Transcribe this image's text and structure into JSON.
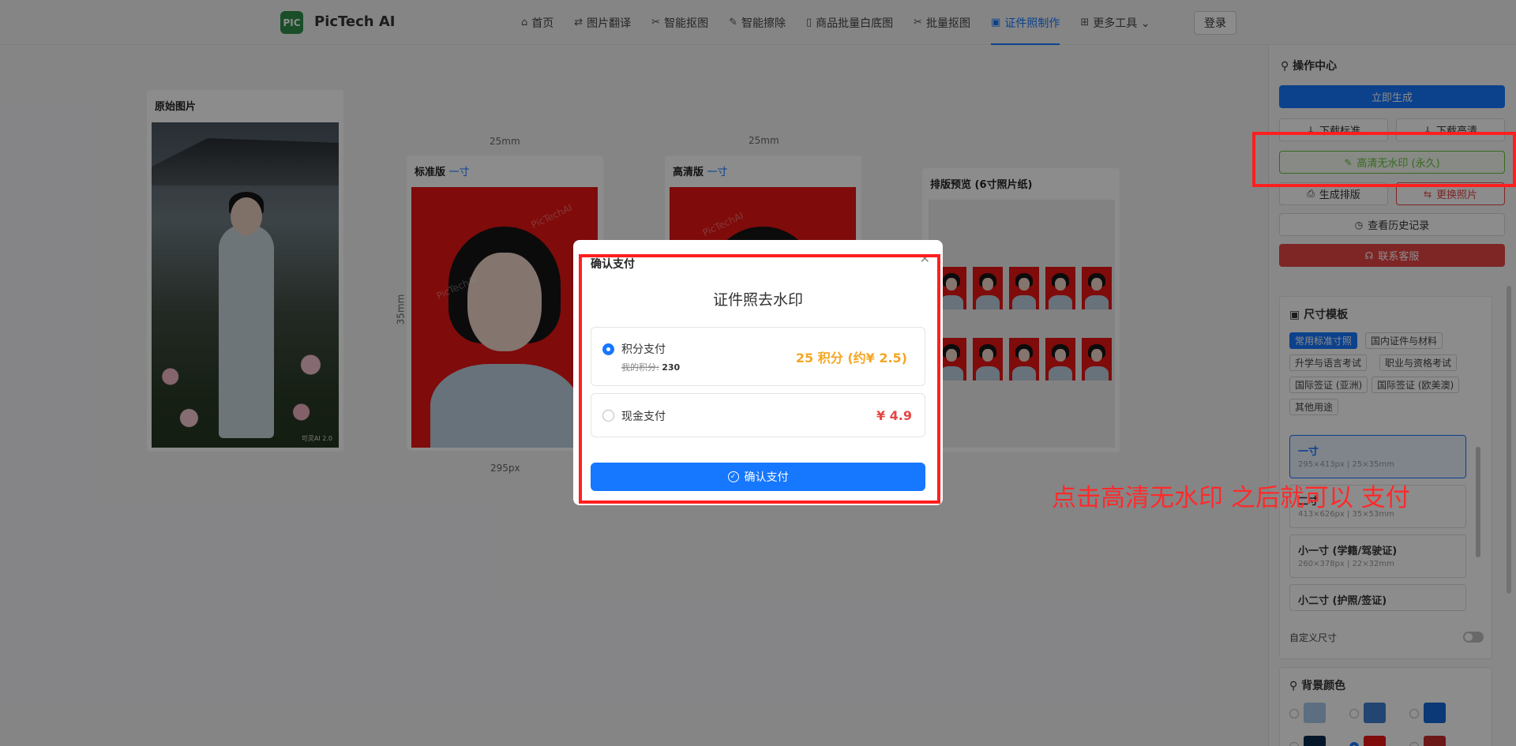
{
  "header": {
    "logo_text": "PIC",
    "brand": "PicTech AI",
    "nav": [
      {
        "icon": "⌂",
        "label": "首页"
      },
      {
        "icon": "⇄",
        "label": "图片翻译"
      },
      {
        "icon": "✂",
        "label": "智能抠图"
      },
      {
        "icon": "✎",
        "label": "智能擦除"
      },
      {
        "icon": "▯",
        "label": "商品批量白底图"
      },
      {
        "icon": "✂",
        "label": "批量抠图"
      },
      {
        "icon": "▣",
        "label": "证件照制作"
      },
      {
        "icon": "⊞",
        "label": "更多工具 ⌄"
      }
    ],
    "active_nav": "证件照制作",
    "login": "登录"
  },
  "canvas": {
    "original_title": "原始图片",
    "original_watermark": "可灵AI 2.0",
    "standard_title_prefix": "标准版",
    "standard_title_size": "一寸",
    "hd_title_prefix": "高清版",
    "hd_title_size": "一寸",
    "width_mm": "25mm",
    "height_mm": "35mm",
    "width_px": "295px",
    "watermark": "PicTechAI",
    "layout_title": "排版预览 (6寸照片纸)"
  },
  "panel": {
    "title": "操作中心",
    "generate": "立即生成",
    "download_standard": "下载标准",
    "download_hd": "下载高清",
    "hd_no_watermark": "高清无水印 (永久)",
    "make_layout": "生成排版",
    "replace_photo": "更换照片",
    "history": "查看历史记录",
    "support": "联系客服",
    "size_section_title": "尺寸模板",
    "size_tabs": [
      "常用标准寸照",
      "国内证件与材料",
      "升学与语言考试",
      "职业与资格考试",
      "国际签证 (亚洲)",
      "国际签证 (欧美澳)",
      "其他用途"
    ],
    "sizes": [
      {
        "name": "一寸",
        "spec": "295×413px | 25×35mm"
      },
      {
        "name": "二寸",
        "spec": "413×626px | 35×53mm"
      },
      {
        "name": "小一寸 (学籍/驾驶证)",
        "spec": "260×378px | 22×32mm"
      },
      {
        "name": "小二寸 (护照/签证)",
        "spec": ""
      }
    ],
    "custom_size": "自定义尺寸",
    "bg_section_title": "背景颜色",
    "bg_colors": [
      "#a9c9ec",
      "#3f7fcf",
      "#1466d8",
      "#0e2a4f",
      "#e81414",
      "#c62d2d"
    ]
  },
  "modal": {
    "title": "确认支付",
    "heading": "证件照去水印",
    "option_points": {
      "label": "积分支付",
      "my_points_label": "我的积分:",
      "my_points_value": "230",
      "price": "25 积分 (约¥ 2.5)"
    },
    "option_cash": {
      "label": "现金支付",
      "price": "¥ 4.9"
    },
    "confirm": "确认支付",
    "check_icon": "✓",
    "close_icon": "✕"
  },
  "annotation": {
    "text": "点击高清无水印 之后就可以 支付",
    "color": "#ff2a2a"
  }
}
